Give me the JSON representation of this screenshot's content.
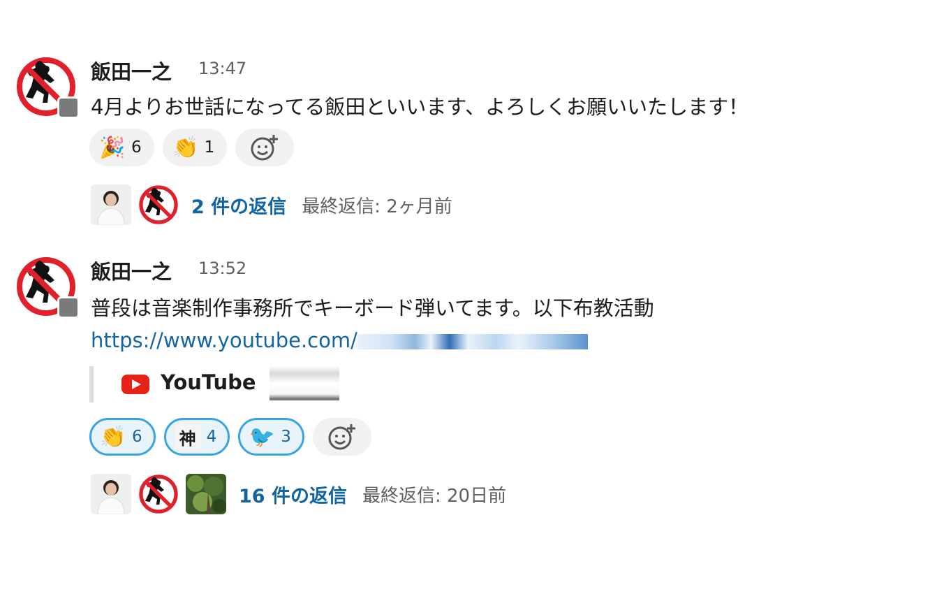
{
  "messages": [
    {
      "author": "飯田一之",
      "time": "13:47",
      "text": "4月よりお世話になってる飯田といいます、よろしくお願いいたします！",
      "reactions": [
        {
          "emoji": "party-popper",
          "glyph": "🎉",
          "count": "6",
          "mine": false
        },
        {
          "emoji": "clapping-hands",
          "glyph": "👏",
          "count": "1",
          "mine": false
        }
      ],
      "thread": {
        "replies": "2 件の返信",
        "last_reply": "最終返信: 2ヶ月前"
      }
    },
    {
      "author": "飯田一之",
      "time": "13:52",
      "text": "普段は音楽制作事務所でキーボード弾いてます。以下布教活動",
      "link": "https://www.youtube.com/",
      "unfurl": {
        "site": "YouTube"
      },
      "reactions": [
        {
          "emoji": "clapping-hands",
          "glyph": "👏",
          "count": "6",
          "mine": true
        },
        {
          "emoji": "kami-custom-emoji",
          "glyph": "神",
          "count": "4",
          "mine": true
        },
        {
          "emoji": "blue-bird-custom-emoji",
          "glyph": "🐦",
          "count": "3",
          "mine": true
        }
      ],
      "thread": {
        "replies": "16 件の返信",
        "last_reply": "最終返信: 20日前"
      }
    }
  ],
  "colors": {
    "link": "#1264a3",
    "reaction_active_border": "#3aa3e3",
    "muted": "#616061"
  }
}
